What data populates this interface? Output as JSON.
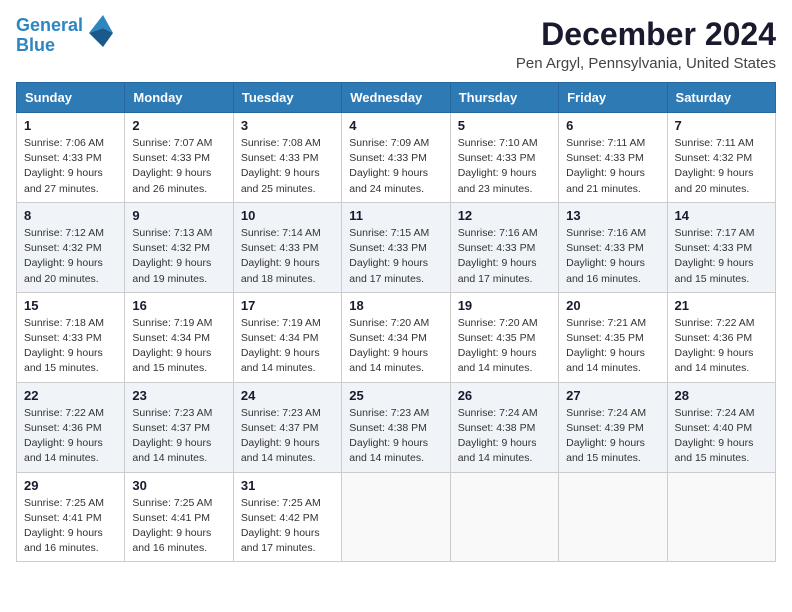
{
  "header": {
    "logo_line1": "General",
    "logo_line2": "Blue",
    "title": "December 2024",
    "subtitle": "Pen Argyl, Pennsylvania, United States"
  },
  "weekdays": [
    "Sunday",
    "Monday",
    "Tuesday",
    "Wednesday",
    "Thursday",
    "Friday",
    "Saturday"
  ],
  "weeks": [
    [
      {
        "day": "1",
        "sunrise": "Sunrise: 7:06 AM",
        "sunset": "Sunset: 4:33 PM",
        "daylight": "Daylight: 9 hours and 27 minutes."
      },
      {
        "day": "2",
        "sunrise": "Sunrise: 7:07 AM",
        "sunset": "Sunset: 4:33 PM",
        "daylight": "Daylight: 9 hours and 26 minutes."
      },
      {
        "day": "3",
        "sunrise": "Sunrise: 7:08 AM",
        "sunset": "Sunset: 4:33 PM",
        "daylight": "Daylight: 9 hours and 25 minutes."
      },
      {
        "day": "4",
        "sunrise": "Sunrise: 7:09 AM",
        "sunset": "Sunset: 4:33 PM",
        "daylight": "Daylight: 9 hours and 24 minutes."
      },
      {
        "day": "5",
        "sunrise": "Sunrise: 7:10 AM",
        "sunset": "Sunset: 4:33 PM",
        "daylight": "Daylight: 9 hours and 23 minutes."
      },
      {
        "day": "6",
        "sunrise": "Sunrise: 7:11 AM",
        "sunset": "Sunset: 4:33 PM",
        "daylight": "Daylight: 9 hours and 21 minutes."
      },
      {
        "day": "7",
        "sunrise": "Sunrise: 7:11 AM",
        "sunset": "Sunset: 4:32 PM",
        "daylight": "Daylight: 9 hours and 20 minutes."
      }
    ],
    [
      {
        "day": "8",
        "sunrise": "Sunrise: 7:12 AM",
        "sunset": "Sunset: 4:32 PM",
        "daylight": "Daylight: 9 hours and 20 minutes."
      },
      {
        "day": "9",
        "sunrise": "Sunrise: 7:13 AM",
        "sunset": "Sunset: 4:32 PM",
        "daylight": "Daylight: 9 hours and 19 minutes."
      },
      {
        "day": "10",
        "sunrise": "Sunrise: 7:14 AM",
        "sunset": "Sunset: 4:33 PM",
        "daylight": "Daylight: 9 hours and 18 minutes."
      },
      {
        "day": "11",
        "sunrise": "Sunrise: 7:15 AM",
        "sunset": "Sunset: 4:33 PM",
        "daylight": "Daylight: 9 hours and 17 minutes."
      },
      {
        "day": "12",
        "sunrise": "Sunrise: 7:16 AM",
        "sunset": "Sunset: 4:33 PM",
        "daylight": "Daylight: 9 hours and 17 minutes."
      },
      {
        "day": "13",
        "sunrise": "Sunrise: 7:16 AM",
        "sunset": "Sunset: 4:33 PM",
        "daylight": "Daylight: 9 hours and 16 minutes."
      },
      {
        "day": "14",
        "sunrise": "Sunrise: 7:17 AM",
        "sunset": "Sunset: 4:33 PM",
        "daylight": "Daylight: 9 hours and 15 minutes."
      }
    ],
    [
      {
        "day": "15",
        "sunrise": "Sunrise: 7:18 AM",
        "sunset": "Sunset: 4:33 PM",
        "daylight": "Daylight: 9 hours and 15 minutes."
      },
      {
        "day": "16",
        "sunrise": "Sunrise: 7:19 AM",
        "sunset": "Sunset: 4:34 PM",
        "daylight": "Daylight: 9 hours and 15 minutes."
      },
      {
        "day": "17",
        "sunrise": "Sunrise: 7:19 AM",
        "sunset": "Sunset: 4:34 PM",
        "daylight": "Daylight: 9 hours and 14 minutes."
      },
      {
        "day": "18",
        "sunrise": "Sunrise: 7:20 AM",
        "sunset": "Sunset: 4:34 PM",
        "daylight": "Daylight: 9 hours and 14 minutes."
      },
      {
        "day": "19",
        "sunrise": "Sunrise: 7:20 AM",
        "sunset": "Sunset: 4:35 PM",
        "daylight": "Daylight: 9 hours and 14 minutes."
      },
      {
        "day": "20",
        "sunrise": "Sunrise: 7:21 AM",
        "sunset": "Sunset: 4:35 PM",
        "daylight": "Daylight: 9 hours and 14 minutes."
      },
      {
        "day": "21",
        "sunrise": "Sunrise: 7:22 AM",
        "sunset": "Sunset: 4:36 PM",
        "daylight": "Daylight: 9 hours and 14 minutes."
      }
    ],
    [
      {
        "day": "22",
        "sunrise": "Sunrise: 7:22 AM",
        "sunset": "Sunset: 4:36 PM",
        "daylight": "Daylight: 9 hours and 14 minutes."
      },
      {
        "day": "23",
        "sunrise": "Sunrise: 7:23 AM",
        "sunset": "Sunset: 4:37 PM",
        "daylight": "Daylight: 9 hours and 14 minutes."
      },
      {
        "day": "24",
        "sunrise": "Sunrise: 7:23 AM",
        "sunset": "Sunset: 4:37 PM",
        "daylight": "Daylight: 9 hours and 14 minutes."
      },
      {
        "day": "25",
        "sunrise": "Sunrise: 7:23 AM",
        "sunset": "Sunset: 4:38 PM",
        "daylight": "Daylight: 9 hours and 14 minutes."
      },
      {
        "day": "26",
        "sunrise": "Sunrise: 7:24 AM",
        "sunset": "Sunset: 4:38 PM",
        "daylight": "Daylight: 9 hours and 14 minutes."
      },
      {
        "day": "27",
        "sunrise": "Sunrise: 7:24 AM",
        "sunset": "Sunset: 4:39 PM",
        "daylight": "Daylight: 9 hours and 15 minutes."
      },
      {
        "day": "28",
        "sunrise": "Sunrise: 7:24 AM",
        "sunset": "Sunset: 4:40 PM",
        "daylight": "Daylight: 9 hours and 15 minutes."
      }
    ],
    [
      {
        "day": "29",
        "sunrise": "Sunrise: 7:25 AM",
        "sunset": "Sunset: 4:41 PM",
        "daylight": "Daylight: 9 hours and 16 minutes."
      },
      {
        "day": "30",
        "sunrise": "Sunrise: 7:25 AM",
        "sunset": "Sunset: 4:41 PM",
        "daylight": "Daylight: 9 hours and 16 minutes."
      },
      {
        "day": "31",
        "sunrise": "Sunrise: 7:25 AM",
        "sunset": "Sunset: 4:42 PM",
        "daylight": "Daylight: 9 hours and 17 minutes."
      },
      null,
      null,
      null,
      null
    ]
  ]
}
